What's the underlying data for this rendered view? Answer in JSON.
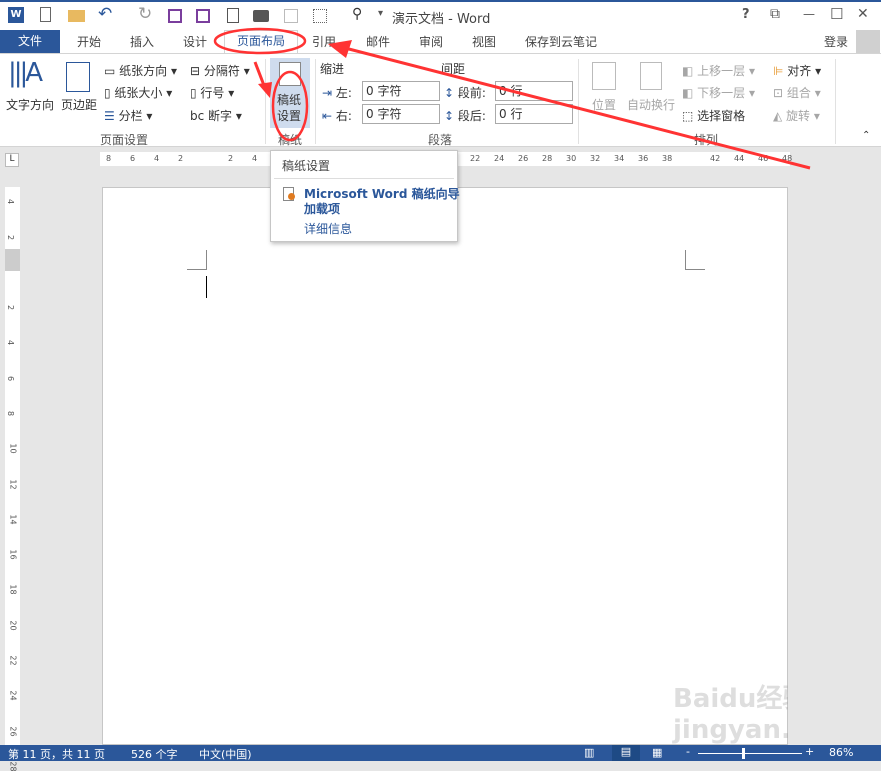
{
  "window": {
    "title": "演示文档 - Word",
    "help": "?",
    "ribbon_display": "⧉",
    "minimize": "—",
    "maximize": "☐",
    "close": "✕"
  },
  "qat": {
    "icons": [
      "word-icon",
      "new-icon",
      "open-icon",
      "undo-icon",
      "redo-icon",
      "save-icon",
      "save-as-icon",
      "print-preview-icon",
      "print-icon",
      "table-icon",
      "border-icon",
      "find-icon"
    ],
    "customize": "▾"
  },
  "tabs": {
    "file": "文件",
    "items": [
      "开始",
      "插入",
      "设计",
      "页面布局",
      "引用",
      "邮件",
      "审阅",
      "视图",
      "保存到云笔记"
    ],
    "active": "页面布局",
    "login": "登录"
  },
  "ribbon": {
    "page_setup": {
      "text_direction": "文字方向",
      "margins": "页边距",
      "orientation": "纸张方向",
      "size": "纸张大小",
      "columns": "分栏",
      "breaks": "分隔符",
      "line_numbers": "行号",
      "hyphenation": "断字",
      "label": "页面设置"
    },
    "manuscript": {
      "button": [
        "稿纸",
        "设置"
      ],
      "label": "稿纸"
    },
    "paragraph": {
      "indent": "缩进",
      "spacing": "间距",
      "left_label": "左:",
      "left_value": "0 字符",
      "right_label": "右:",
      "right_value": "0 字符",
      "before_label": "段前:",
      "before_value": "0 行",
      "after_label": "段后:",
      "after_value": "0 行",
      "label": "段落"
    },
    "arrange": {
      "position": "位置",
      "wrap": "自动换行",
      "bring_forward": "上移一层",
      "send_backward": "下移一层",
      "selection_pane": "选择窗格",
      "align": "对齐",
      "group": "组合",
      "rotate": "旋转",
      "label": "排列"
    }
  },
  "ruler": {
    "horizontal": [
      "8",
      "6",
      "4",
      "2",
      "2",
      "4",
      "22",
      "24",
      "26",
      "28",
      "30",
      "32",
      "34",
      "36",
      "38",
      "42",
      "44",
      "46",
      "48"
    ],
    "vertical": [
      "4",
      "2",
      "2",
      "4",
      "6",
      "8",
      "10",
      "12",
      "14",
      "16",
      "18",
      "20",
      "22",
      "24",
      "26",
      "28"
    ]
  },
  "tooltip": {
    "title": "稿纸设置",
    "addin": "Microsoft Word 稿纸向导",
    "addin2": "加载项",
    "more": "详细信息"
  },
  "status": {
    "page": "第 11 页，共 11 页",
    "words": "526 个字",
    "lang": "中文(中国)",
    "zoom": "86%",
    "zoom_minus": "-",
    "zoom_plus": "+"
  },
  "watermark": "Baidu经验 jingyan.baidu.com",
  "annotation_color": "#ff3333",
  "accent": "#2b579a"
}
